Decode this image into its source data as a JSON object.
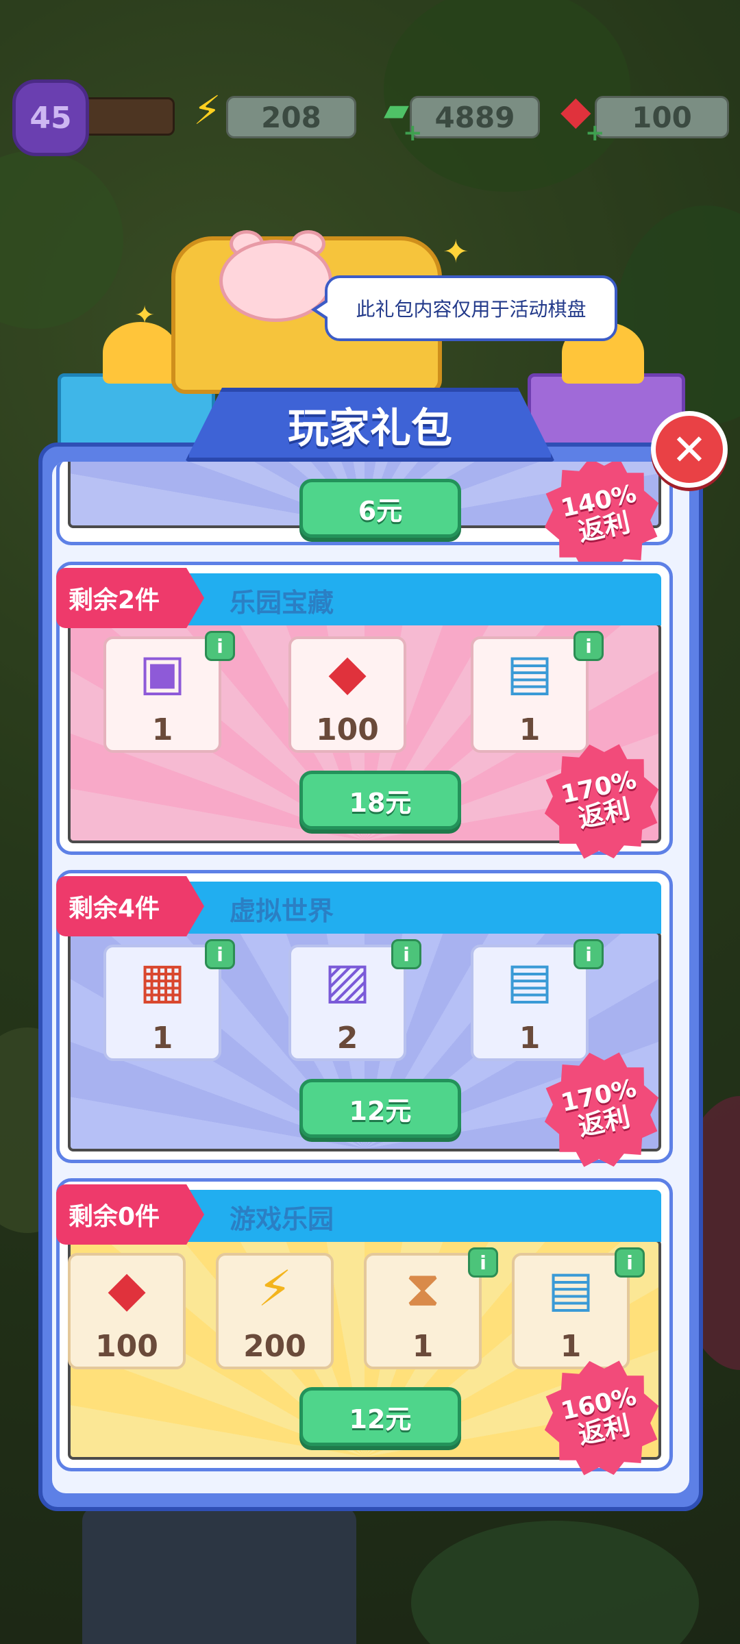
{
  "hud": {
    "level": "45",
    "energy": "208",
    "cash": "4889",
    "gems": "100",
    "icons": [
      "level-badge",
      "lightning-icon",
      "cash-icon",
      "ruby-icon"
    ]
  },
  "tooltip": "此礼包内容仅用于活动棋盘",
  "panel": {
    "title": "玩家礼包",
    "close_label": "✕"
  },
  "packs": [
    {
      "name": "",
      "remaining": "",
      "price": "6元",
      "rebate_pct": "140%",
      "rebate_label": "返利"
    },
    {
      "name": "乐园宝藏",
      "remaining": "剩余2件",
      "price": "18元",
      "rebate_pct": "170%",
      "rebate_label": "返利",
      "items": [
        {
          "icon": "mystery-box-icon",
          "qty": "1"
        },
        {
          "icon": "ruby-icon",
          "qty": "100"
        },
        {
          "icon": "seed-packet-icon",
          "qty": "1"
        }
      ]
    },
    {
      "name": "虚拟世界",
      "remaining": "剩余4件",
      "price": "12元",
      "rebate_pct": "170%",
      "rebate_label": "返利",
      "items": [
        {
          "icon": "coin-case-icon",
          "qty": "1"
        },
        {
          "icon": "game-card-icon",
          "qty": "2"
        },
        {
          "icon": "seed-packet-icon",
          "qty": "1"
        }
      ]
    },
    {
      "name": "游戏乐园",
      "remaining": "剩余0件",
      "price": "12元",
      "rebate_pct": "160%",
      "rebate_label": "返利",
      "items": [
        {
          "icon": "ruby-icon",
          "qty": "100"
        },
        {
          "icon": "lightning-icon",
          "qty": "200"
        },
        {
          "icon": "hourglass-tile-icon",
          "qty": "1"
        },
        {
          "icon": "seed-packet-icon",
          "qty": "1"
        }
      ]
    }
  ],
  "colors": {
    "panel_blue": "#5d80e6",
    "header_cyan": "#21aef0",
    "tag_pink": "#ee3a6b",
    "price_green": "#4fd58b",
    "rebate_pink": "#f24b7a",
    "close_red": "#e94145"
  }
}
